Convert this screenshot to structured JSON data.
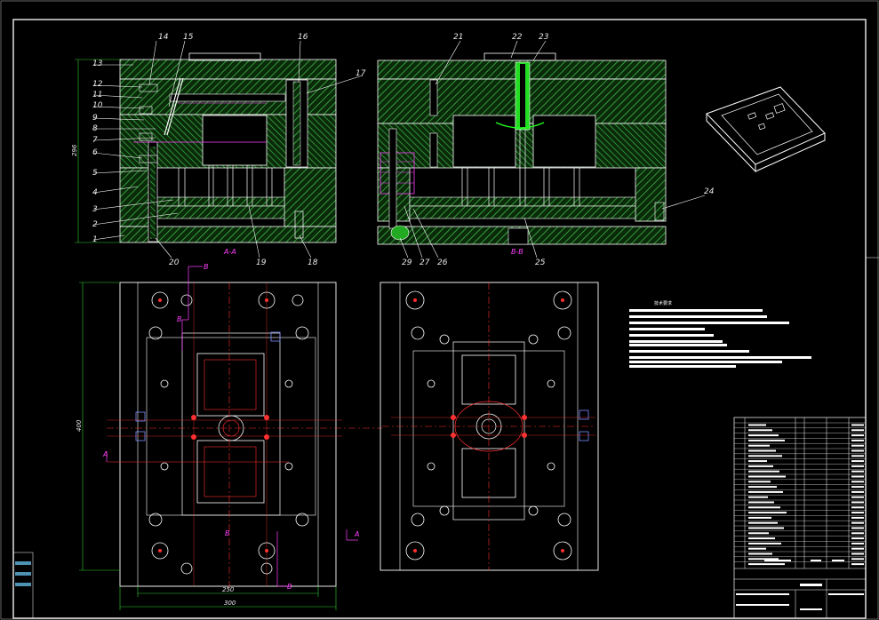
{
  "part_numbers_a": [
    "14",
    "15",
    "16",
    "17",
    "13",
    "12",
    "11",
    "10",
    "9",
    "8",
    "7",
    "6",
    "5",
    "4",
    "3",
    "2",
    "1",
    "20",
    "19",
    "18"
  ],
  "part_numbers_b": [
    "21",
    "22",
    "23",
    "24",
    "29",
    "27",
    "26",
    "25"
  ],
  "section_labels": {
    "a": "A-A",
    "b": "B-B"
  },
  "cut_markers": {
    "a": "A",
    "b": "B"
  },
  "dimensions": {
    "height": "296",
    "plate_height": "400",
    "inner_width": "250",
    "outer_width": "300"
  },
  "notes": {
    "title": "技术要求"
  },
  "colors": {
    "hatch": "#3fb84a",
    "outline": "#ffffff",
    "center": "#ff3030",
    "dim": "#2fd22f",
    "section": "#ff40ff"
  }
}
